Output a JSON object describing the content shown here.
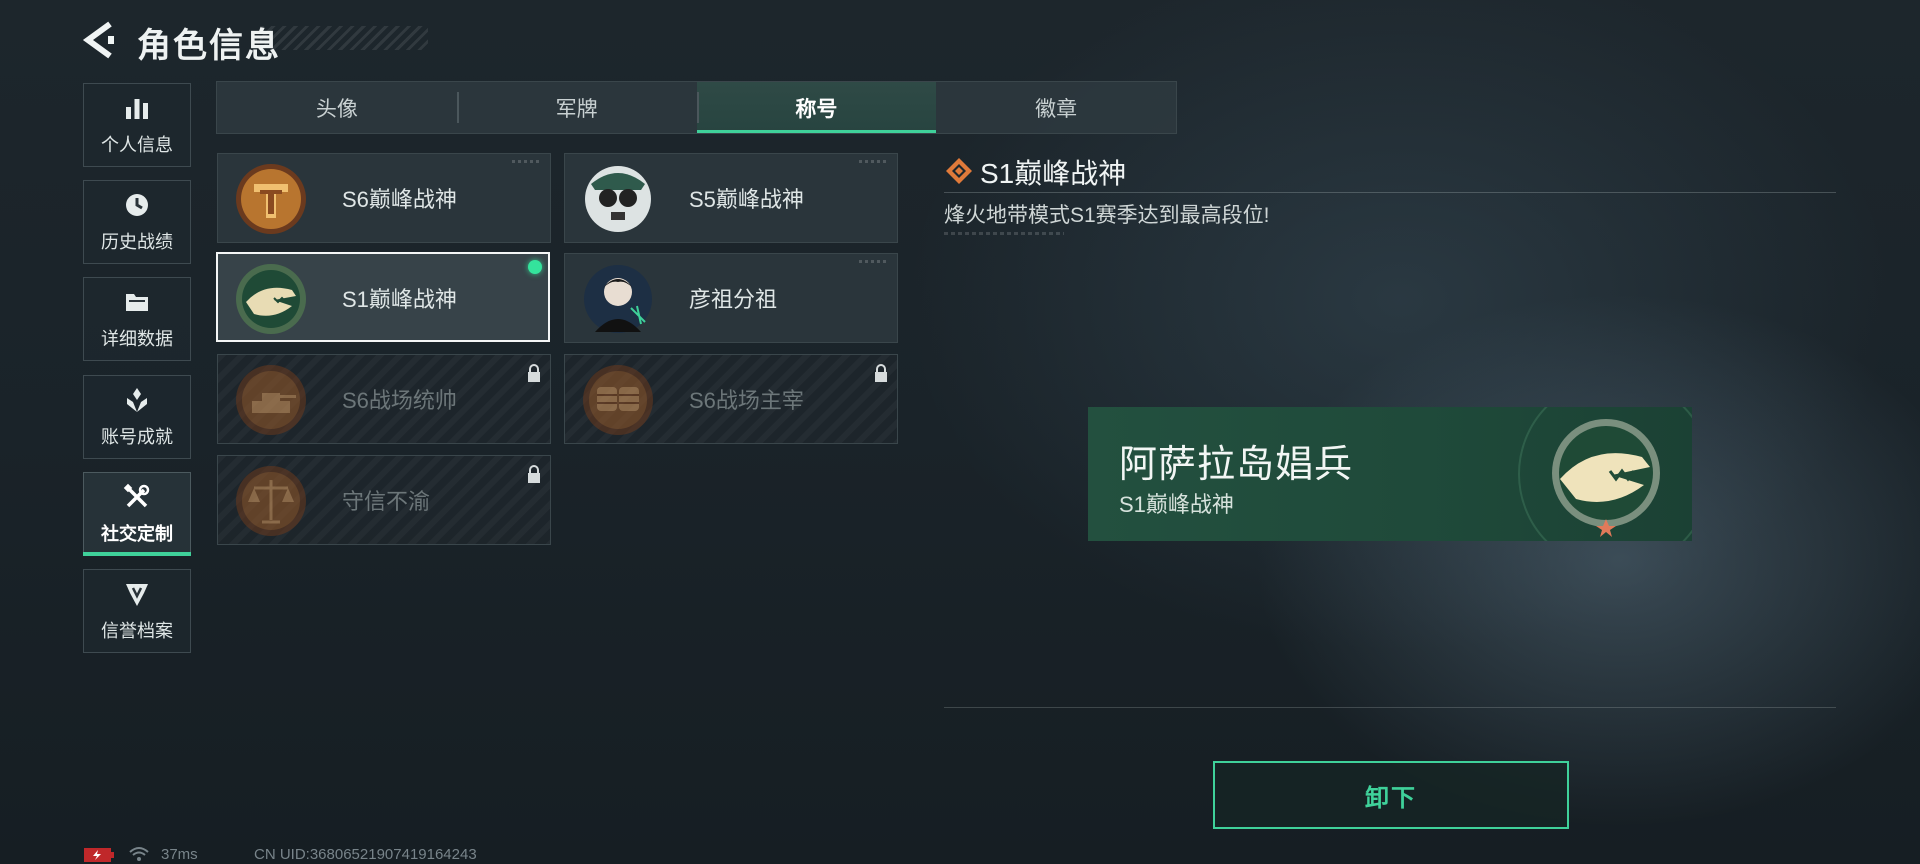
{
  "header": {
    "title": "角色信息",
    "back_icon": "back-arrow-icon"
  },
  "sidebar": {
    "items": [
      {
        "label": "个人信息",
        "icon": "bar-chart-icon"
      },
      {
        "label": "历史战绩",
        "icon": "history-clock-icon"
      },
      {
        "label": "详细数据",
        "icon": "folder-icon"
      },
      {
        "label": "账号成就",
        "icon": "achievement-icon"
      },
      {
        "label": "社交定制",
        "icon": "tools-icon",
        "active": true
      },
      {
        "label": "信誉档案",
        "icon": "shield-icon"
      }
    ]
  },
  "tabs": [
    {
      "label": "头像"
    },
    {
      "label": "军牌"
    },
    {
      "label": "称号",
      "active": true
    },
    {
      "label": "徽章"
    }
  ],
  "titles": [
    {
      "label": "S6巅峰战神",
      "icon": "gold-helmet-emblem-icon",
      "locked": false
    },
    {
      "label": "S5巅峰战神",
      "icon": "skull-goggles-emblem-icon",
      "locked": false
    },
    {
      "label": "S1巅峰战神",
      "icon": "crocodile-emblem-icon",
      "locked": false,
      "selected": true,
      "equipped": true
    },
    {
      "label": "彦祖分祖",
      "icon": "portrait-avatar-icon",
      "locked": false
    },
    {
      "label": "S6战场统帅",
      "icon": "tank-emblem-icon",
      "locked": true
    },
    {
      "label": "S6战场主宰",
      "icon": "crossed-fists-emblem-icon",
      "locked": true
    },
    {
      "label": "守信不渝",
      "icon": "scales-emblem-icon",
      "locked": true
    }
  ],
  "detail": {
    "title": "S1巅峰战神",
    "description": "烽火地带模式S1赛季达到最高段位!",
    "title_icon": "diamond-rank-icon"
  },
  "preview": {
    "player_name": "阿萨拉岛娼兵",
    "title": "S1巅峰战神",
    "badge_icon": "crocodile-emblem-icon"
  },
  "actions": {
    "unequip_label": "卸下"
  },
  "status": {
    "ping": "37ms",
    "uid": "CN UID:36806521907419164243",
    "battery_icon": "battery-charging-icon",
    "wifi_icon": "wifi-icon"
  },
  "colors": {
    "accent": "#3fd19a",
    "equipped_dot": "#34e39c",
    "preview_bg": "#23503f",
    "detail_icon": "#e07a3a"
  }
}
